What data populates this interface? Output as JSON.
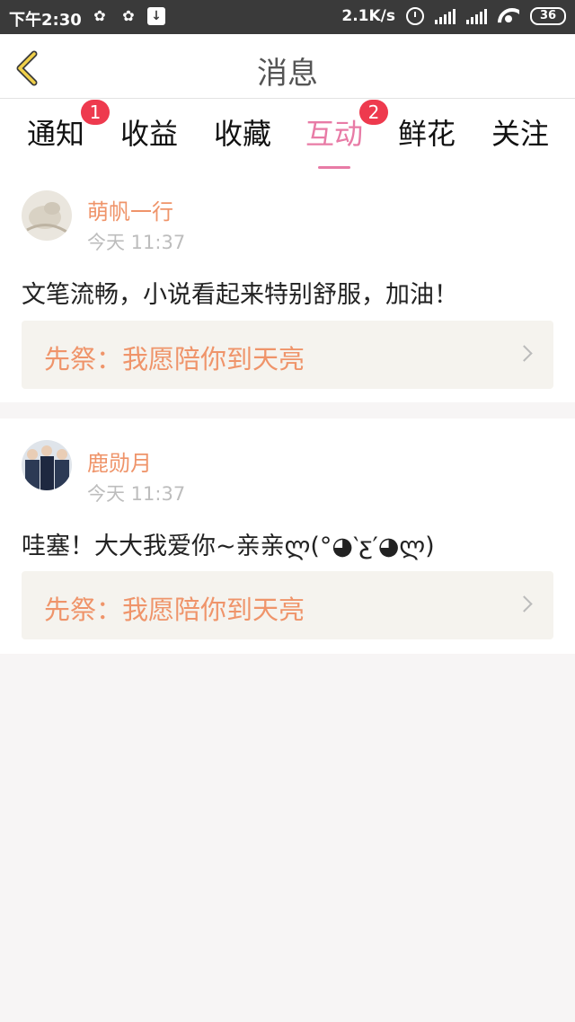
{
  "status_bar": {
    "time": "下午2:30",
    "app_icons": [
      "wechat-icon",
      "wechat-icon",
      "download-icon"
    ],
    "net_speed": "2.1K/s",
    "battery": "36"
  },
  "header": {
    "title": "消息",
    "back_icon": "chevron-left-icon"
  },
  "tabs": [
    {
      "label": "通知",
      "badge": "1",
      "active": false
    },
    {
      "label": "收益",
      "badge": "",
      "active": false
    },
    {
      "label": "收藏",
      "badge": "",
      "active": false
    },
    {
      "label": "互动",
      "badge": "2",
      "active": true
    },
    {
      "label": "鲜花",
      "badge": "",
      "active": false
    },
    {
      "label": "关注",
      "badge": "",
      "active": false
    }
  ],
  "colors": {
    "accent": "#e87ba6",
    "badge": "#ee3a4e",
    "username": "#ef946a",
    "work_link_bg": "#f5f3ee"
  },
  "messages": [
    {
      "username": "萌帆一行",
      "time": "今天 11:37",
      "comment": "文笔流畅，小说看起来特别舒服，加油！",
      "work_title": "先祭：我愿陪你到天亮"
    },
    {
      "username": "鹿勋月",
      "time": "今天 11:37",
      "comment": "哇塞！大大我爱你~亲亲ლ(°◕‵ƹ′◕ლ)",
      "work_title": "先祭：我愿陪你到天亮"
    }
  ]
}
